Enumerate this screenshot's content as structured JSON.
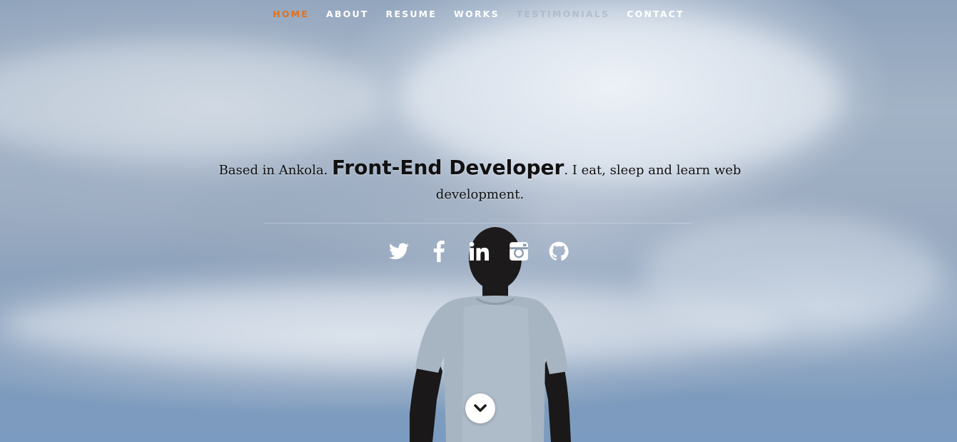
{
  "nav": {
    "items": [
      {
        "label": "HOME",
        "state": "active"
      },
      {
        "label": "ABOUT",
        "state": "normal"
      },
      {
        "label": "RESUME",
        "state": "normal"
      },
      {
        "label": "WORKS",
        "state": "normal"
      },
      {
        "label": "TESTIMONIALS",
        "state": "faded"
      },
      {
        "label": "CONTACT",
        "state": "normal"
      }
    ],
    "active_color": "#e0711f"
  },
  "hero": {
    "intro": "Based in Ankola.",
    "role": "Front-End Developer",
    "tagline": ". I eat, sleep and learn web development."
  },
  "social": {
    "icons": [
      "twitter-icon",
      "facebook-icon",
      "linkedin-icon",
      "instagram-icon",
      "github-icon"
    ]
  },
  "scroll": {
    "icon": "chevron-down-icon"
  }
}
